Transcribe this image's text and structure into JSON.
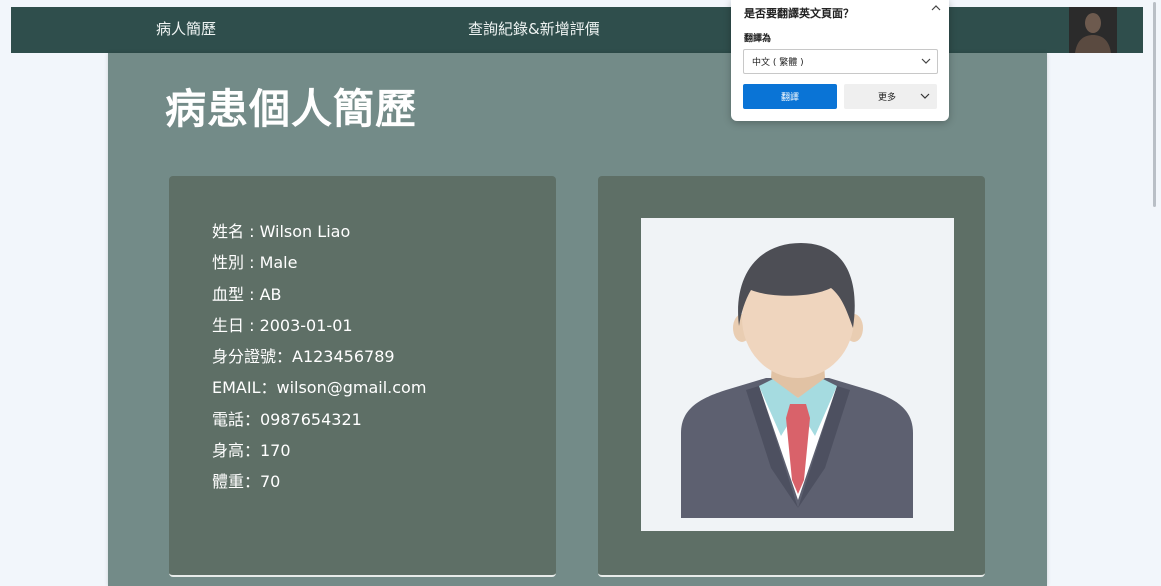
{
  "nav": {
    "profile_link": "病人簡歷",
    "records_link": "查詢紀錄&新增評價",
    "avatar_icon": "user-avatar-photo"
  },
  "page": {
    "title": "病患個人簡歷"
  },
  "patient": {
    "fields": [
      "姓名 : Wilson Liao",
      "性別 : Male",
      "血型 : AB",
      "生日 : 2003-01-01",
      "身分證號：A123456789",
      "EMAIL：wilson@gmail.com",
      "電話：0987654321",
      "身高：170",
      "體重：70"
    ],
    "photo_icon": "businessman-avatar-illustration"
  },
  "translate_popup": {
    "title": "是否要翻譯英文頁面？",
    "target_label": "翻譯為",
    "selected_language": "中文 ( 繁體 )",
    "translate_button": "翻譯",
    "more_button": "更多"
  },
  "colors": {
    "navbar": "#2f4e4c",
    "panel": "#738b88",
    "card": "#5e6f66",
    "accent_blue": "#0a74d6"
  }
}
